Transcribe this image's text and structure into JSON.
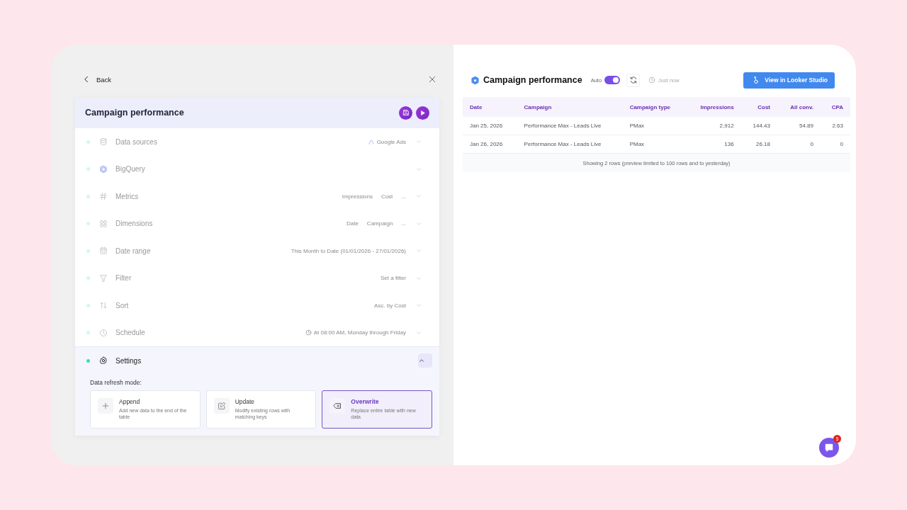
{
  "left": {
    "back": "Back",
    "title": "Campaign performance",
    "rows": [
      {
        "kind": "database",
        "label": "Data sources",
        "values": [
          "Google Ads"
        ],
        "expanded": false
      },
      {
        "kind": "bigquery",
        "label": "BigQuery",
        "values": [],
        "expanded": false
      },
      {
        "kind": "hash",
        "label": "Metrics",
        "values": [
          "Impressions",
          "Cost",
          "..."
        ],
        "expanded": false
      },
      {
        "kind": "grid",
        "label": "Dimensions",
        "values": [
          "Date",
          "Campaign",
          "..."
        ],
        "expanded": false
      },
      {
        "kind": "calendar",
        "label": "Date range",
        "values": [
          "This Month to Date (01/01/2026 - 27/01/2026)"
        ],
        "expanded": false
      },
      {
        "kind": "filter",
        "label": "Filter",
        "values": [
          "Set a filter"
        ],
        "expanded": false
      },
      {
        "kind": "sort",
        "label": "Sort",
        "values": [
          "Asc. by Cost"
        ],
        "expanded": false
      },
      {
        "kind": "clock",
        "label": "Schedule",
        "values": [
          "At 08:00 AM, Monday through Friday"
        ],
        "expanded": false
      },
      {
        "kind": "gear",
        "label": "Settings",
        "values": [],
        "expanded": true
      }
    ],
    "settings": {
      "label": "Data refresh mode:",
      "options": [
        {
          "kind": "plus",
          "title": "Append",
          "desc": "Add new data to the end of the table",
          "selected": false
        },
        {
          "kind": "edit",
          "title": "Update",
          "desc": "Modify existing rows with matching keys",
          "selected": false
        },
        {
          "kind": "erase",
          "title": "Overwrite",
          "desc": "Replace entire table with new data",
          "selected": true
        }
      ]
    }
  },
  "right": {
    "title": "Campaign performance",
    "auto_label": "Auto",
    "auto_on": true,
    "updated": "Just now",
    "looker_button": "View in Looker Studio",
    "table": {
      "columns": [
        "Date",
        "Campaign",
        "Campaign type",
        "Impressions",
        "Cost",
        "All conv.",
        "CPA"
      ],
      "rows": [
        [
          "Jan 25, 2026",
          "Performance Max - Leads Live",
          "PMax",
          "2,912",
          "144.43",
          "54.89",
          "2.63"
        ],
        [
          "Jan 26, 2026",
          "Performance Max - Leads Live",
          "PMax",
          "136",
          "26.18",
          "0",
          "0"
        ]
      ],
      "footer": "Showing 2 rows (preview limited to 100 rows and to yesterday)"
    }
  },
  "chat": {
    "badge": "5"
  }
}
